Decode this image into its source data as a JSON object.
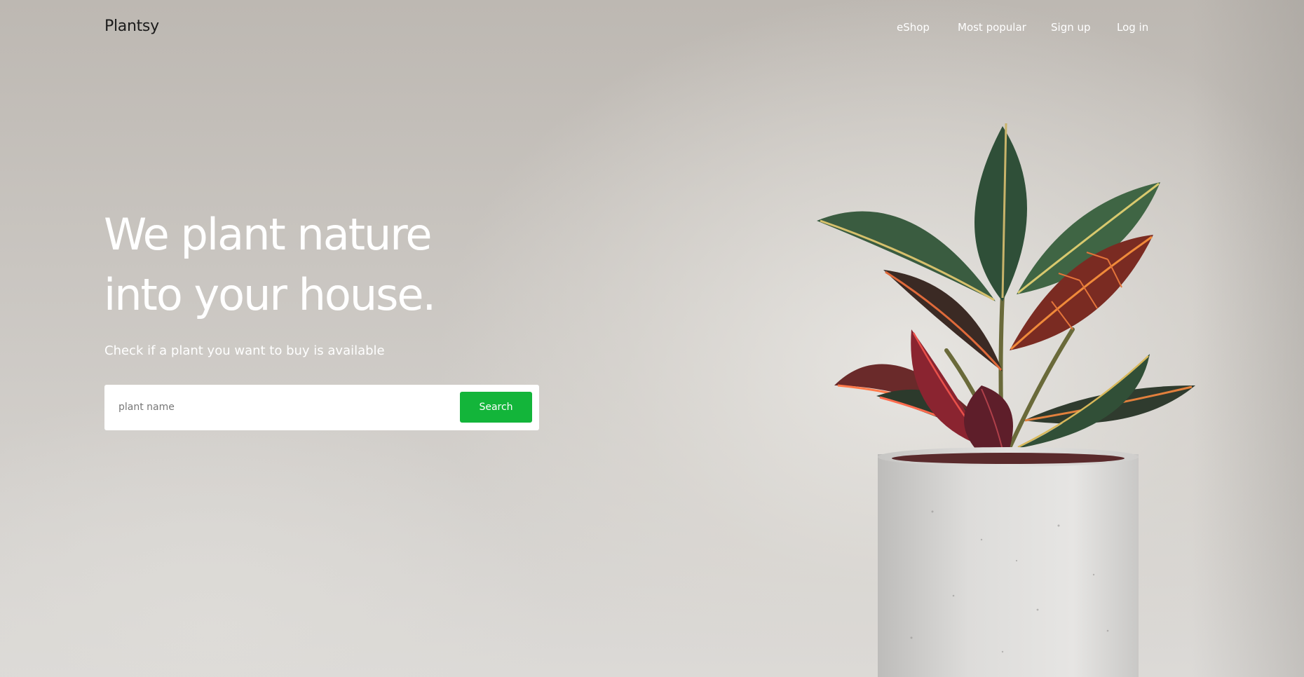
{
  "header": {
    "logo": "Plantsy",
    "nav": {
      "eshop": "eShop",
      "most_popular": "Most popular",
      "sign_up": "Sign up",
      "log_in": "Log in"
    }
  },
  "hero": {
    "headline_line1": "We plant nature",
    "headline_line2": "into your house.",
    "subline": "Check if a plant you want to buy is available",
    "search": {
      "placeholder": "plant name",
      "value": "",
      "button_label": "Search"
    }
  },
  "colors": {
    "accent": "#13b53a",
    "background": "#c9c5c0",
    "text_light": "#ffffff",
    "text_dark": "#1b1b1b"
  },
  "icons": [
    "potted-plant-image"
  ]
}
